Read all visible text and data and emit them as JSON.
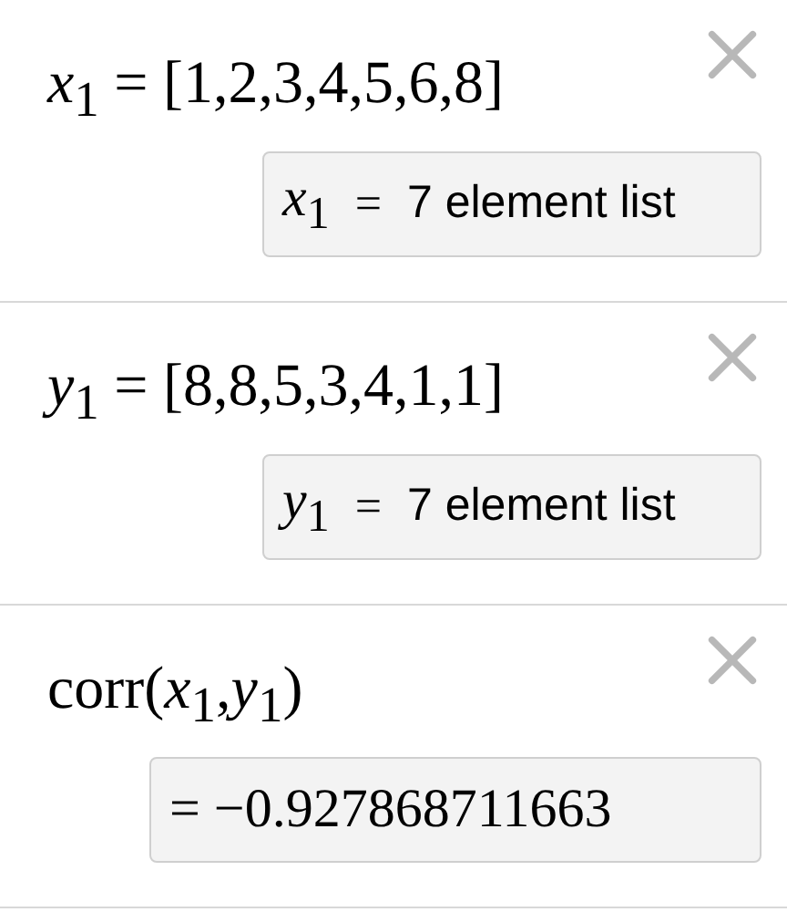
{
  "expressions": [
    {
      "formula": "*x*$_{1}$ = [1,2,3,4,5,6,8]",
      "result": {
        "kind": "list",
        "variable": "*x*$_{1}$",
        "equals": "=",
        "text": "7 element list"
      }
    },
    {
      "formula": "*y*$_{1}$ = [8,8,5,3,4,1,1]",
      "result": {
        "kind": "list",
        "variable": "*y*$_{1}$",
        "equals": "=",
        "text": "7 element list"
      }
    },
    {
      "formula": "corr(*x*$_{1}$,*y*$_{1}$)",
      "result": {
        "kind": "value",
        "text": "= −0.927868711663"
      }
    }
  ]
}
